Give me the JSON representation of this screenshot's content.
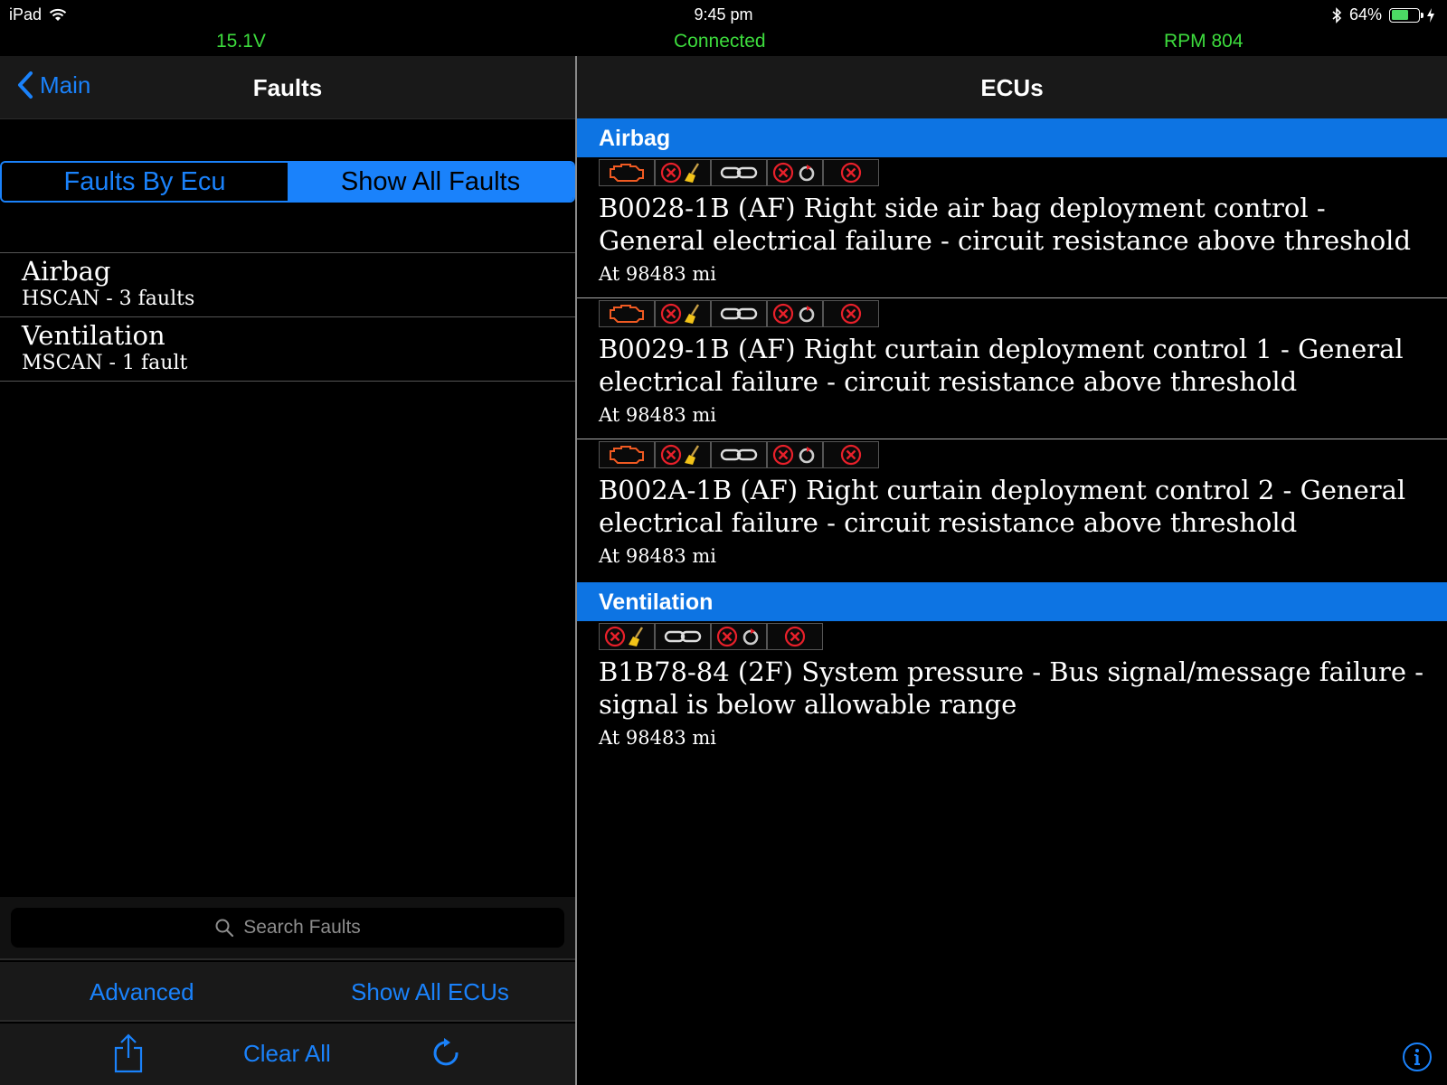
{
  "status_bar": {
    "device": "iPad",
    "time": "9:45 pm",
    "battery": "64%",
    "battery_level": 0.64
  },
  "telemetry": {
    "voltage": "15.1V",
    "connection": "Connected",
    "rpm": "RPM 804"
  },
  "left": {
    "back_label": "Main",
    "title": "Faults",
    "segments": [
      "Faults By Ecu",
      "Show All Faults"
    ],
    "selected_segment": "Show All Faults",
    "ecus": [
      {
        "name": "Airbag",
        "detail": "HSCAN - 3 faults"
      },
      {
        "name": "Ventilation",
        "detail": "MSCAN - 1 fault"
      }
    ],
    "search_placeholder": "Search Faults",
    "advanced_label": "Advanced",
    "show_all_ecus_label": "Show All ECUs",
    "clear_all_label": "Clear All"
  },
  "right": {
    "title": "ECUs",
    "sections": [
      {
        "name": "Airbag",
        "faults": [
          {
            "desc": "B0028-1B (AF) Right side air bag deployment control - General electrical failure - circuit resistance above threshold",
            "meta": "At 98483 mi",
            "icons": [
              "engine-icon",
              "clear-fault-icon",
              "chain-link-icon",
              "fault-timer-icon",
              "fault-error-icon"
            ]
          },
          {
            "desc": "B0029-1B (AF) Right curtain deployment control 1 - General electrical failure - circuit resistance above threshold",
            "meta": "At 98483 mi",
            "icons": [
              "engine-icon",
              "clear-fault-icon",
              "chain-link-icon",
              "fault-timer-icon",
              "fault-error-icon"
            ]
          },
          {
            "desc": "B002A-1B (AF) Right curtain deployment control 2 - General electrical failure - circuit resistance above threshold",
            "meta": "At 98483 mi",
            "icons": [
              "engine-icon",
              "clear-fault-icon",
              "chain-link-icon",
              "fault-timer-icon",
              "fault-error-icon"
            ]
          }
        ]
      },
      {
        "name": "Ventilation",
        "faults": [
          {
            "desc": "B1B78-84 (2F) System pressure - Bus signal/message failure - signal is below allowable range",
            "meta": "At 98483 mi",
            "icons": [
              "clear-fault-icon",
              "chain-link-icon",
              "fault-timer-icon",
              "fault-error-icon"
            ]
          }
        ]
      }
    ]
  },
  "colors": {
    "accent": "#1a82fb",
    "section_header": "#0d74e3",
    "telemetry": "#3ddc3d",
    "error_red": "#e8202a",
    "engine_orange": "#f05a22"
  }
}
